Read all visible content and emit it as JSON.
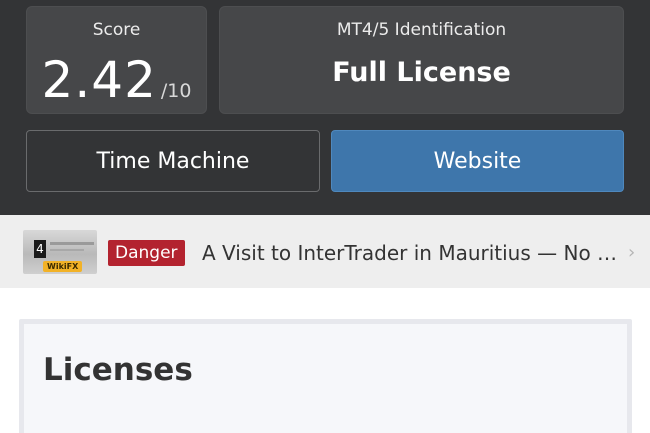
{
  "score": {
    "label": "Score",
    "value": "2.42",
    "out_of": "/10"
  },
  "mt": {
    "label": "MT4/5 Identification",
    "value": "Full License"
  },
  "buttons": {
    "time_machine": "Time Machine",
    "website": "Website"
  },
  "news": {
    "thumb_number": "4",
    "thumb_badge": "WikiFX",
    "badge": "Danger",
    "title": "A Visit to InterTrader in Mauritius — No …",
    "chevron": "›"
  },
  "licenses": {
    "title": "Licenses"
  },
  "colors": {
    "header_bg": "#333436",
    "card_bg": "#464749",
    "accent_blue": "#3e76ab",
    "danger_red": "#b3232f"
  }
}
